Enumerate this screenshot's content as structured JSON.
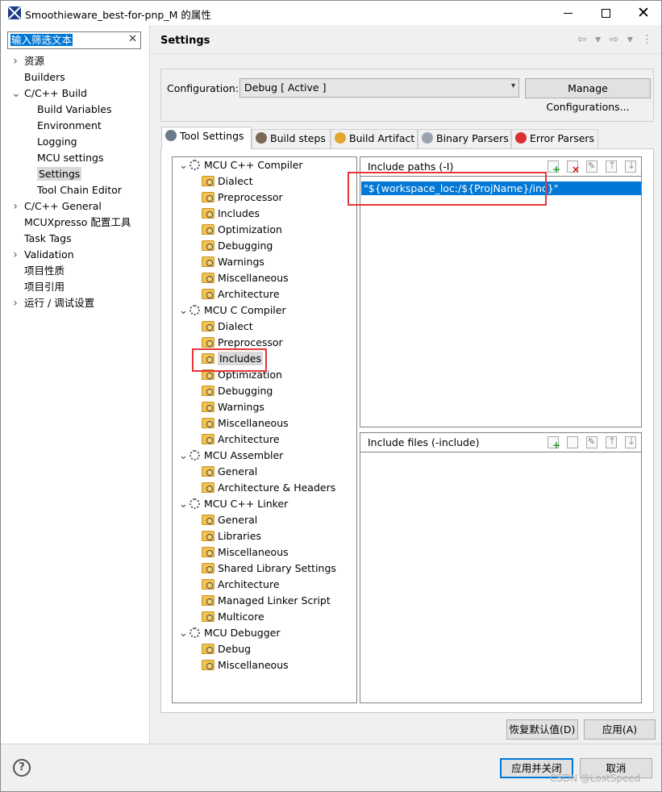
{
  "window": {
    "title": "Smoothieware_best-for-pnp_M 的属性",
    "minimize_label": "",
    "maximize_label": "",
    "close_label": "✕"
  },
  "nav": {
    "filter_text": "输入筛选文本",
    "items": [
      {
        "label": "资源",
        "level": 0,
        "expander": "right"
      },
      {
        "label": "Builders",
        "level": 0,
        "expander": "none"
      },
      {
        "label": "C/C++ Build",
        "level": 0,
        "expander": "down"
      },
      {
        "label": "Build Variables",
        "level": 1,
        "expander": "none"
      },
      {
        "label": "Environment",
        "level": 1,
        "expander": "none"
      },
      {
        "label": "Logging",
        "level": 1,
        "expander": "none"
      },
      {
        "label": "MCU settings",
        "level": 1,
        "expander": "none"
      },
      {
        "label": "Settings",
        "level": 1,
        "expander": "none",
        "selected": true
      },
      {
        "label": "Tool Chain Editor",
        "level": 1,
        "expander": "none"
      },
      {
        "label": "C/C++ General",
        "level": 0,
        "expander": "right"
      },
      {
        "label": "MCUXpresso 配置工具",
        "level": 0,
        "expander": "none"
      },
      {
        "label": "Task Tags",
        "level": 0,
        "expander": "none"
      },
      {
        "label": "Validation",
        "level": 0,
        "expander": "right"
      },
      {
        "label": "项目性质",
        "level": 0,
        "expander": "none"
      },
      {
        "label": "项目引用",
        "level": 0,
        "expander": "none"
      },
      {
        "label": "运行 / 调试设置",
        "level": 0,
        "expander": "right"
      }
    ]
  },
  "header": {
    "title": "Settings",
    "nav_arrows": "⇦ ▾ ⇨ ▾ ⋮"
  },
  "config": {
    "label": "Configuration:",
    "value": "Debug  [ Active ]",
    "manage_label": "Manage Configurations..."
  },
  "tabs": [
    {
      "label": "Tool Settings",
      "icon": "tool-settings-icon",
      "active": true
    },
    {
      "label": "Build steps",
      "icon": "build-steps-icon"
    },
    {
      "label": "Build Artifact",
      "icon": "build-artifact-icon"
    },
    {
      "label": "Binary Parsers",
      "icon": "binary-parsers-icon"
    },
    {
      "label": "Error Parsers",
      "icon": "error-parsers-icon"
    }
  ],
  "tree": [
    {
      "label": "MCU C++ Compiler",
      "type": "tool",
      "children": [
        "Dialect",
        "Preprocessor",
        "Includes",
        "Optimization",
        "Debugging",
        "Warnings",
        "Miscellaneous",
        "Architecture"
      ]
    },
    {
      "label": "MCU C Compiler",
      "type": "tool",
      "children": [
        "Dialect",
        "Preprocessor",
        "Includes",
        "Optimization",
        "Debugging",
        "Warnings",
        "Miscellaneous",
        "Architecture"
      ]
    },
    {
      "label": "MCU Assembler",
      "type": "tool",
      "children": [
        "General",
        "Architecture & Headers"
      ]
    },
    {
      "label": "MCU C++ Linker",
      "type": "tool",
      "children": [
        "General",
        "Libraries",
        "Miscellaneous",
        "Shared Library Settings",
        "Architecture",
        "Managed Linker Script",
        "Multicore"
      ]
    },
    {
      "label": "MCU Debugger",
      "type": "tool",
      "children": [
        "Debug",
        "Miscellaneous"
      ]
    }
  ],
  "include_paths": {
    "title": "Include paths (-I)",
    "entries": [
      "\"${workspace_loc:/${ProjName}/inc}\""
    ]
  },
  "include_files": {
    "title": "Include files (-include)",
    "entries": []
  },
  "buttons": {
    "restore_defaults": "恢复默认值(D)",
    "apply": "应用(A)",
    "apply_and_close": "应用并关闭",
    "cancel": "取消"
  },
  "watermark": "CSDN @LostSpeed",
  "help_icon": "?",
  "colors": {
    "selection": "#0078d7",
    "highlight_box": "#e8353b"
  }
}
